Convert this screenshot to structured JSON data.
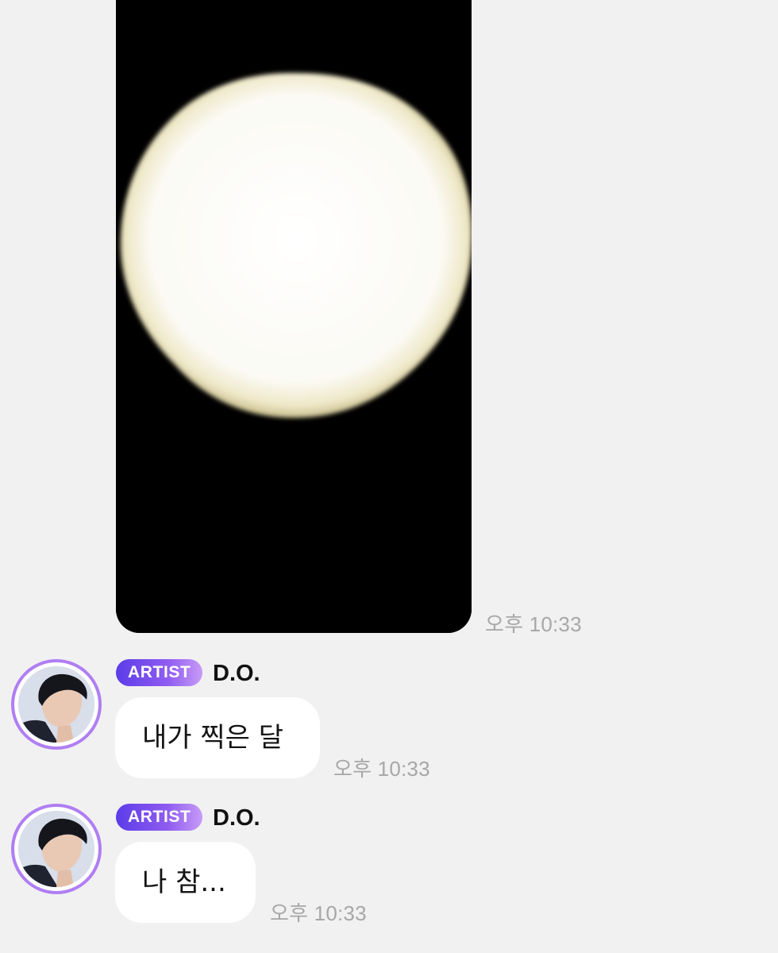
{
  "photo_message": {
    "timestamp": "오후 10:33",
    "image_description_icon": "moon-photo"
  },
  "messages": [
    {
      "badge": "ARTIST",
      "sender": "D.O.",
      "text": "내가 찍은 달",
      "timestamp": "오후 10:33"
    },
    {
      "badge": "ARTIST",
      "sender": "D.O.",
      "text": "나 참...",
      "timestamp": "오후 10:33"
    }
  ],
  "colors": {
    "background": "#f1f1f1",
    "bubble": "#ffffff",
    "badge_start": "#5c3ce8",
    "badge_end": "#c79bf6",
    "avatar_ring": "#b07ef3",
    "timestamp": "#a7a7a7"
  }
}
